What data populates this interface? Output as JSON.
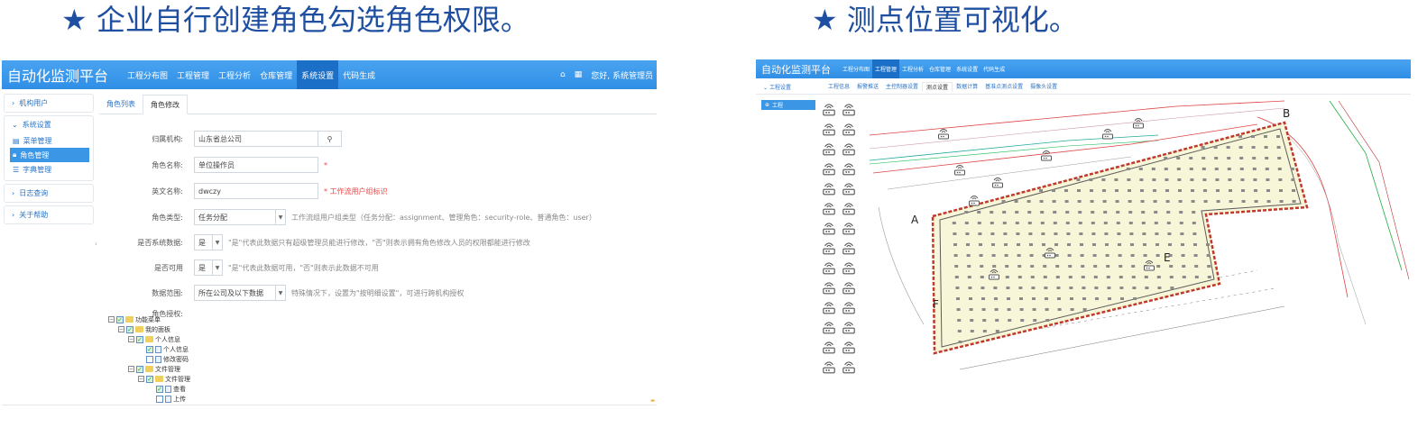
{
  "headings": {
    "left": "★ 企业自行创建角色勾选角色权限。",
    "right": "★ 测点位置可视化。"
  },
  "left_app": {
    "brand": "自动化监测平台",
    "nav": [
      "工程分布图",
      "工程管理",
      "工程分析",
      "仓库管理",
      "系统设置",
      "代码生成"
    ],
    "nav_active_index": 4,
    "home_icon": "home-icon",
    "grid_icon": "grid-icon",
    "greeting": "您好, 系统管理员",
    "sidebar": {
      "org_users": "机构用户",
      "system_settings": "系统设置",
      "items": [
        "菜单管理",
        "角色管理",
        "字典管理"
      ],
      "active_item_index": 1,
      "log_query": "日志查询",
      "about_help": "关于帮助"
    },
    "tabs": [
      "角色列表",
      "角色修改"
    ],
    "active_tab_index": 1,
    "form": {
      "org_label": "归属机构:",
      "org_value": "山东省总公司",
      "name_label": "角色名称:",
      "name_value": "单位操作员",
      "name_required": "*",
      "en_label": "英文名称:",
      "en_value": "dwczy",
      "en_hint": "* 工作流用户组标识",
      "type_label": "角色类型:",
      "type_value": "任务分配",
      "type_hint": "工作流组用户组类型（任务分配：assignment、管理角色：security-role、普通角色：user）",
      "sysdata_label": "是否系统数据:",
      "sysdata_value": "是",
      "sysdata_hint": "\"是\"代表此数据只有超级管理员能进行修改，\"否\"则表示拥有角色修改人员的权限都能进行修改",
      "usable_label": "是否可用",
      "usable_value": "是",
      "usable_hint": "\"是\"代表此数据可用，\"否\"则表示此数据不可用",
      "scope_label": "数据范围:",
      "scope_value": "所在公司及以下数据",
      "scope_hint": "特殊情况下，设置为\"按明细设置\"，可进行跨机构授权",
      "auth_label": "角色授权:"
    },
    "tree": [
      {
        "label": "功能菜单",
        "level": 0,
        "type": "folder",
        "checked": true,
        "expander": "⊟"
      },
      {
        "label": "我的面板",
        "level": 1,
        "type": "folder",
        "checked": true,
        "expander": "⊟"
      },
      {
        "label": "个人信息",
        "level": 2,
        "type": "folder",
        "checked": true,
        "expander": "⊟"
      },
      {
        "label": "个人信息",
        "level": 3,
        "type": "doc",
        "checked": true,
        "expander": ""
      },
      {
        "label": "修改密码",
        "level": 3,
        "type": "doc",
        "checked": false,
        "expander": ""
      },
      {
        "label": "文件管理",
        "level": 2,
        "type": "folder",
        "checked": true,
        "expander": "⊟"
      },
      {
        "label": "文件管理",
        "level": 3,
        "type": "folder",
        "checked": true,
        "expander": "⊟"
      },
      {
        "label": "查看",
        "level": 4,
        "type": "doc",
        "checked": true,
        "expander": ""
      },
      {
        "label": "上传",
        "level": 4,
        "type": "doc",
        "checked": false,
        "expander": ""
      }
    ]
  },
  "right_app": {
    "brand": "自动化监测平台",
    "nav": [
      "工程分布图",
      "工程管理",
      "工程分析",
      "仓库管理",
      "系统设置",
      "代码生成"
    ],
    "nav_active_index": 1,
    "side_title": "工程设置",
    "tabs": [
      "工程信息",
      "报警推送",
      "主控制器设置",
      "测点设置",
      "数据计算",
      "基准点测点设置",
      "摄像头设置"
    ],
    "active_tab_index": 3,
    "project_item": "工程",
    "map_labels": [
      "A",
      "B",
      "E",
      "F"
    ],
    "sensor_icon": "wireless-sensor-icon"
  }
}
